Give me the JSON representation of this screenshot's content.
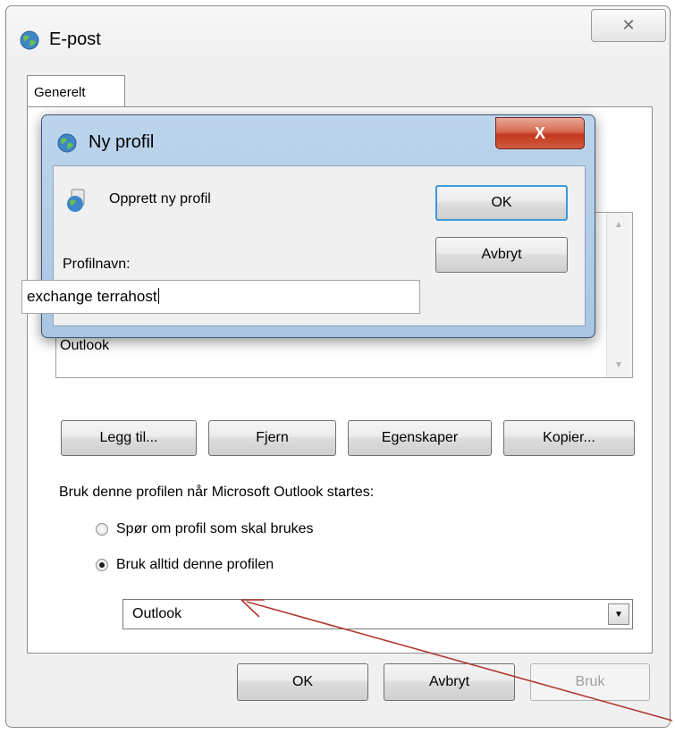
{
  "window": {
    "title": "E-post",
    "close_glyph": "✕",
    "icon": "globe-icon"
  },
  "tabs": [
    {
      "label": "Generelt",
      "selected": true
    }
  ],
  "profile_list": {
    "items": [
      "Outlook"
    ]
  },
  "profile_buttons": {
    "add": "Legg til...",
    "remove": "Fjern",
    "properties": "Egenskaper",
    "copy": "Kopier..."
  },
  "startup": {
    "heading": "Bruk denne profilen når Microsoft Outlook startes:",
    "option_ask": "Spør om profil som skal brukes",
    "option_always": "Bruk alltid denne profilen",
    "selected_option": "always",
    "profile_value": "Outlook"
  },
  "footer": {
    "ok": "OK",
    "cancel": "Avbryt",
    "apply": "Bruk",
    "apply_enabled": false
  },
  "dialog": {
    "title": "Ny profil",
    "close_glyph": "X",
    "message": "Opprett ny profil",
    "field_label": "Profilnavn:",
    "field_value": "exchange terrahost",
    "ok": "OK",
    "cancel": "Avbryt"
  },
  "annotation": {
    "type": "arrow",
    "color": "#b0392f"
  }
}
